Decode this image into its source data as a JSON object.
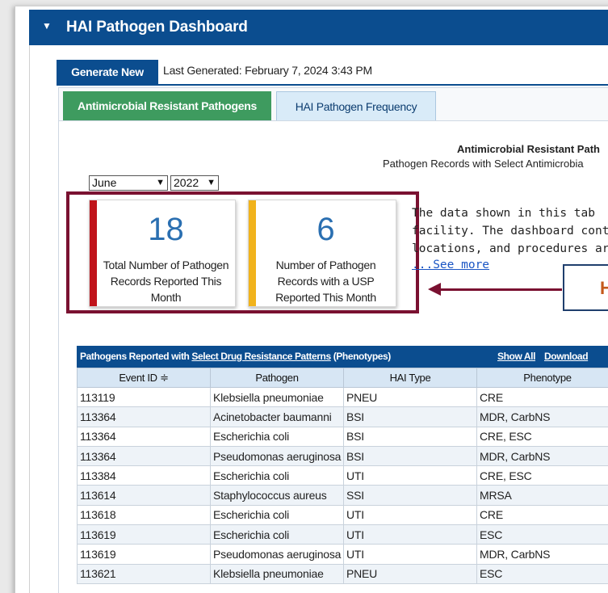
{
  "header": {
    "title": "HAI Pathogen Dashboard"
  },
  "toolbar": {
    "generate_label": "Generate New",
    "last_generated": "Last Generated: February 7, 2024 3:43 PM"
  },
  "tabs": [
    {
      "label": "Antimicrobial Resistant Pathogens",
      "active": true
    },
    {
      "label": "HAI Pathogen Frequency",
      "active": false
    }
  ],
  "section": {
    "title": "Antimicrobial Resistant Path",
    "subtitle": "Pathogen Records with Select Antimicrobia"
  },
  "filters": {
    "month": "June",
    "year": "2022"
  },
  "cards": [
    {
      "value": "18",
      "label": "Total Number of Pathogen Records Reported This Month",
      "color": "#c0141b"
    },
    {
      "value": "6",
      "label": "Number of Pathogen Records with a USP Reported This Month",
      "color": "#f1b31c"
    }
  ],
  "description": {
    "line1": "The data shown in this tab",
    "line2": "facility. The dashboard cont",
    "line3": "locations, and procedures ar",
    "see_more": "...See more"
  },
  "callout": {
    "text": "H"
  },
  "table": {
    "bar_prefix": "Pathogens Reported with ",
    "bar_link": "Select Drug Resistance Patterns",
    "bar_suffix": " (Phenotypes)",
    "show_all": "Show All",
    "download": "Download",
    "columns": [
      "Event ID ≑",
      "Pathogen",
      "HAI Type",
      "Phenotype"
    ],
    "rows": [
      [
        "113119",
        "Klebsiella pneumoniae",
        "PNEU",
        "CRE"
      ],
      [
        "113364",
        "Acinetobacter baumanni",
        "BSI",
        "MDR, CarbNS"
      ],
      [
        "113364",
        "Escherichia coli",
        "BSI",
        "CRE, ESC"
      ],
      [
        "113364",
        "Pseudomonas aeruginosa",
        "BSI",
        "MDR, CarbNS"
      ],
      [
        "113384",
        "Escherichia coli",
        "UTI",
        "CRE, ESC"
      ],
      [
        "113614",
        "Staphylococcus aureus",
        "SSI",
        "MRSA"
      ],
      [
        "113618",
        "Escherichia coli",
        "UTI",
        "CRE"
      ],
      [
        "113619",
        "Escherichia coli",
        "UTI",
        "ESC"
      ],
      [
        "113619",
        "Pseudomonas aeruginosa",
        "UTI",
        "MDR, CarbNS"
      ],
      [
        "113621",
        "Klebsiella pneumoniae",
        "PNEU",
        "ESC"
      ]
    ]
  },
  "colors": {
    "brand": "#0b4d8f",
    "active_tab": "#3e9b5f",
    "highlight": "#7a1131"
  }
}
